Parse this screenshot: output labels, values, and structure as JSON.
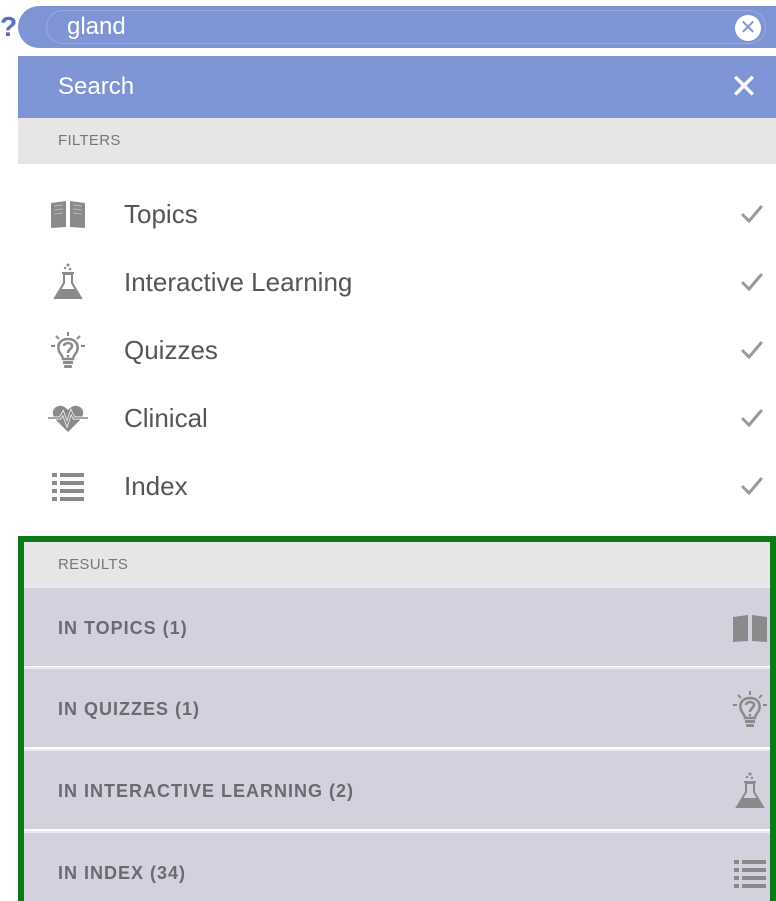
{
  "search": {
    "value": "gland",
    "clear_glyph": "✕"
  },
  "panel": {
    "title": "Search",
    "close_glyph": "✕"
  },
  "filters": {
    "header": "FILTERS",
    "items": [
      {
        "label": "Topics",
        "icon": "book-icon",
        "checked": true
      },
      {
        "label": "Interactive Learning",
        "icon": "flask-icon",
        "checked": true
      },
      {
        "label": "Quizzes",
        "icon": "lightbulb-question-icon",
        "checked": true
      },
      {
        "label": "Clinical",
        "icon": "heartbeat-icon",
        "checked": true
      },
      {
        "label": "Index",
        "icon": "list-icon",
        "checked": true
      }
    ]
  },
  "results": {
    "header": "RESULTS",
    "items": [
      {
        "label": "IN TOPICS (1)",
        "icon": "book-icon"
      },
      {
        "label": "IN QUIZZES (1)",
        "icon": "lightbulb-question-icon"
      },
      {
        "label": "IN INTERACTIVE LEARNING (2)",
        "icon": "flask-icon"
      },
      {
        "label": "IN INDEX (34)",
        "icon": "list-icon"
      }
    ]
  },
  "colors": {
    "header_blue": "#7f94d4",
    "section_grey": "#e6e6e6",
    "result_row": "#d3d1dd",
    "highlight_border": "#0a7a17",
    "icon_grey": "#8a8a8a"
  }
}
